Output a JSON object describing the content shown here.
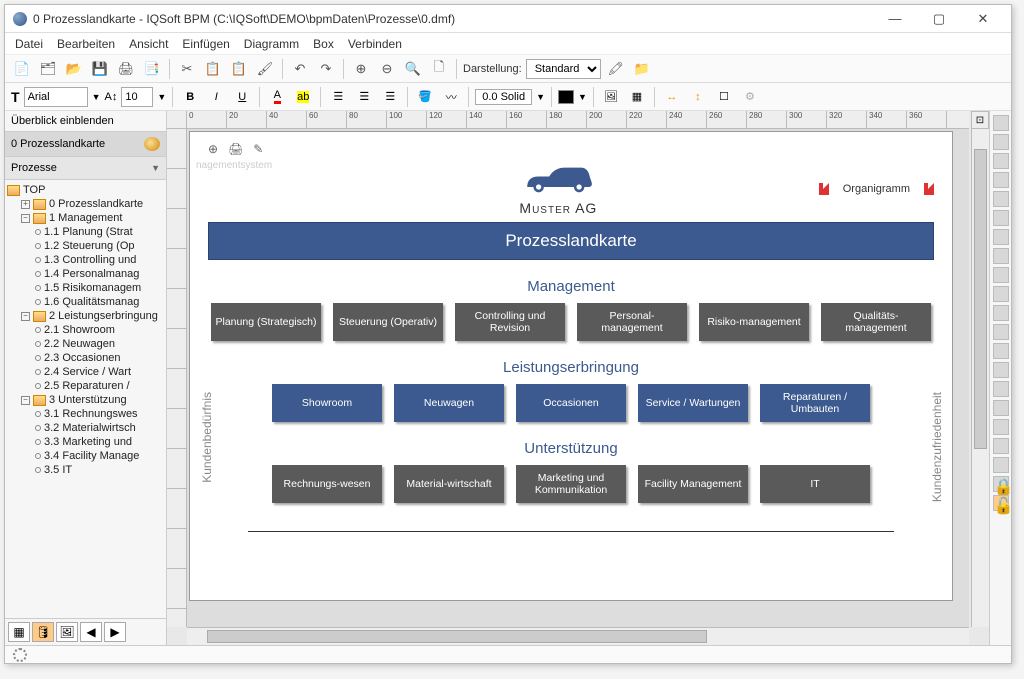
{
  "window": {
    "title": "0 Prozesslandkarte - IQSoft BPM (C:\\IQSoft\\DEMO\\bpmDaten\\Prozesse\\0.dmf)"
  },
  "menu": [
    "Datei",
    "Bearbeiten",
    "Ansicht",
    "Einfügen",
    "Diagramm",
    "Box",
    "Verbinden"
  ],
  "toolbar1": {
    "display_label": "Darstellung:",
    "display_value": "Standard"
  },
  "format": {
    "font": "Arial",
    "size": "10",
    "line_label": "0.0 Solid"
  },
  "sidebar": {
    "header": "Überblick einblenden",
    "tab1": "0 Prozesslandkarte",
    "tab2": "Prozesse",
    "tree": {
      "root": "TOP",
      "n0": "0 Prozesslandkarte",
      "n1": "1 Management",
      "n1c": [
        "1.1 Planung (Strat",
        "1.2 Steuerung (Op",
        "1.3 Controlling und",
        "1.4 Personalmanag",
        "1.5 Risikomanagem",
        "1.6 Qualitätsmanag"
      ],
      "n2": "2 Leistungserbringung",
      "n2c": [
        "2.1 Showroom",
        "2.2 Neuwagen",
        "2.3 Occasionen",
        "2.4 Service / Wart",
        "2.5 Reparaturen /"
      ],
      "n3": "3 Unterstützung",
      "n3c": [
        "3.1 Rechnungswes",
        "3.2 Materialwirtsch",
        "3.3 Marketing und",
        "3.4 Facility Manage",
        "3.5 IT"
      ]
    }
  },
  "ruler": [
    "0",
    "20",
    "40",
    "60",
    "80",
    "100",
    "120",
    "140",
    "160",
    "180",
    "200",
    "220",
    "240",
    "260",
    "280",
    "300",
    "320",
    "340",
    "360"
  ],
  "canvas": {
    "watermark": "nagementsystem",
    "company": "Muster AG",
    "org_link": "Organigramm",
    "title_bar": "Prozesslandkarte",
    "sections": [
      {
        "title": "Management",
        "style": "grey",
        "boxes": [
          "Planung (Strategisch)",
          "Steuerung (Operativ)",
          "Controlling und Revision",
          "Personal-management",
          "Risiko-management",
          "Qualitäts-management"
        ]
      },
      {
        "title": "Leistungserbringung",
        "style": "blue",
        "boxes": [
          "Showroom",
          "Neuwagen",
          "Occasionen",
          "Service / Wartungen",
          "Reparaturen / Umbauten"
        ]
      },
      {
        "title": "Unterstützung",
        "style": "grey",
        "boxes": [
          "Rechnungs-wesen",
          "Material-wirtschaft",
          "Marketing und Kommunikation",
          "Facility Management",
          "IT"
        ]
      }
    ],
    "vert_left": "Kundenbedürfnis",
    "vert_right": "Kundenzufriedenheit"
  }
}
